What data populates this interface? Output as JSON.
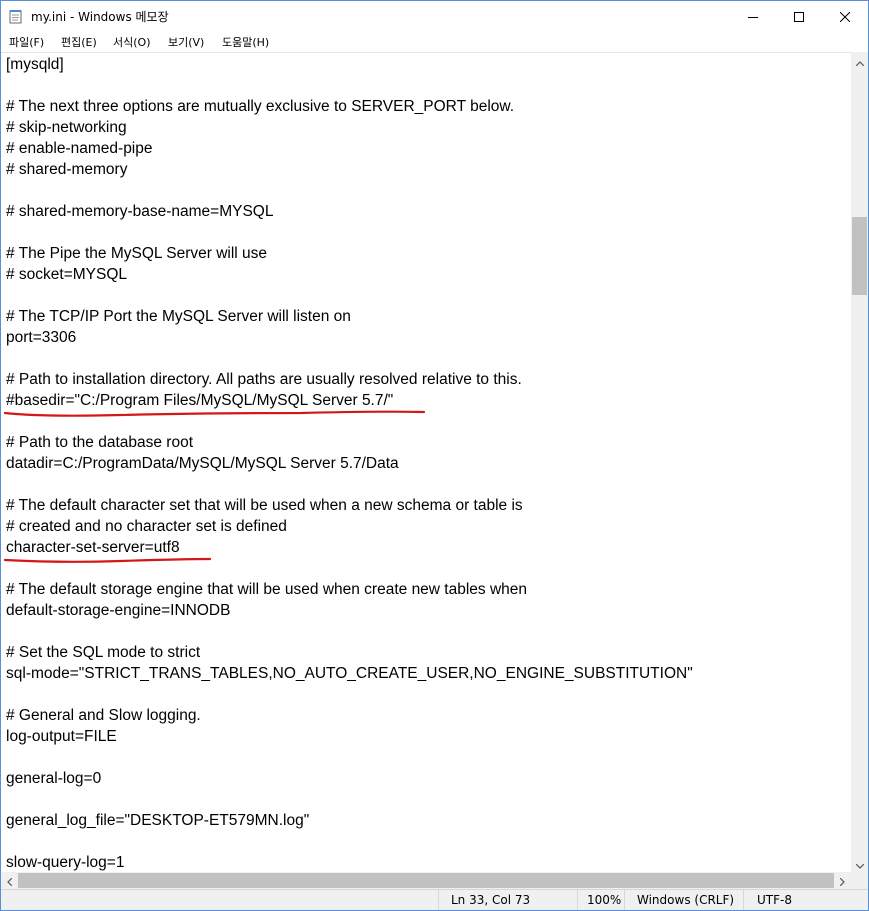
{
  "window": {
    "title": "my.ini - Windows 메모장"
  },
  "menu": {
    "items": [
      "파일(F)",
      "편집(E)",
      "서식(O)",
      "보기(V)",
      "도움말(H)"
    ]
  },
  "editor": {
    "lines": [
      "[mysqld]",
      "",
      "# The next three options are mutually exclusive to SERVER_PORT below.",
      "# skip-networking",
      "# enable-named-pipe",
      "# shared-memory",
      "",
      "# shared-memory-base-name=MYSQL",
      "",
      "# The Pipe the MySQL Server will use",
      "# socket=MYSQL",
      "",
      "# The TCP/IP Port the MySQL Server will listen on",
      "port=3306",
      "",
      "# Path to installation directory. All paths are usually resolved relative to this.",
      "#basedir=\"C:/Program Files/MySQL/MySQL Server 5.7/\"",
      "",
      "# Path to the database root",
      "datadir=C:/ProgramData/MySQL/MySQL Server 5.7/Data",
      "",
      "# The default character set that will be used when a new schema or table is",
      "# created and no character set is defined",
      "character-set-server=utf8",
      "",
      "# The default storage engine that will be used when create new tables when",
      "default-storage-engine=INNODB",
      "",
      "# Set the SQL mode to strict",
      "sql-mode=\"STRICT_TRANS_TABLES,NO_AUTO_CREATE_USER,NO_ENGINE_SUBSTITUTION\"",
      "",
      "# General and Slow logging.",
      "log-output=FILE",
      "",
      "general-log=0",
      "",
      "general_log_file=\"DESKTOP-ET579MN.log\"",
      "",
      "slow-query-log=1"
    ]
  },
  "status": {
    "position": "Ln 33, Col 73",
    "zoom": "100%",
    "line_ending": "Windows (CRLF)",
    "encoding": "UTF-8"
  },
  "colors": {
    "annotation": "#d41717",
    "scrollbar_thumb": "#c1c1c1",
    "statusbar_bg": "#f0f0f0"
  },
  "icons": {
    "app": "notepad-icon",
    "minimize": "minimize-icon",
    "maximize": "maximize-icon",
    "close": "close-icon"
  }
}
